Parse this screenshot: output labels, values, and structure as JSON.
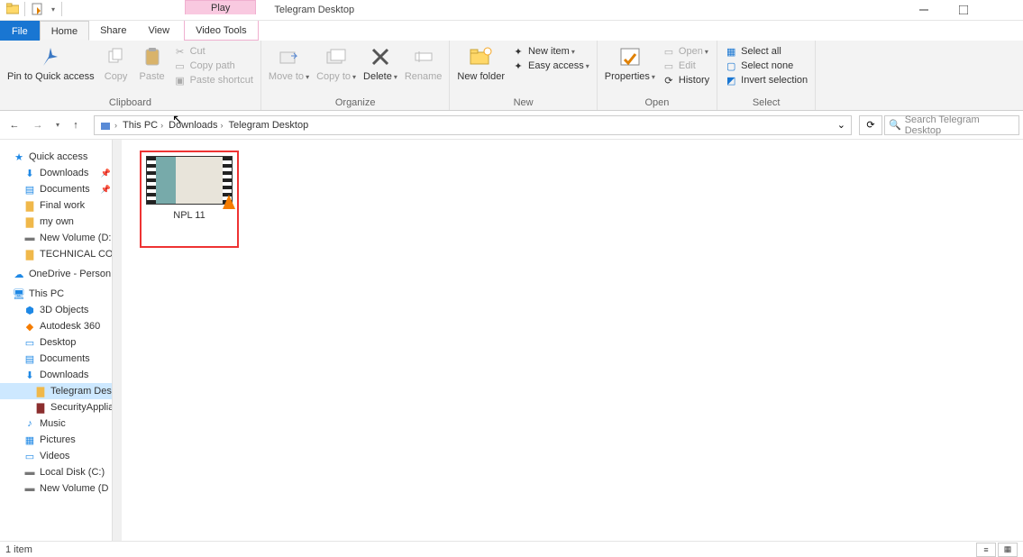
{
  "window": {
    "title": "Telegram Desktop",
    "play_label": "Play"
  },
  "tabs": {
    "file": "File",
    "home": "Home",
    "share": "Share",
    "view": "View",
    "video_tools": "Video Tools"
  },
  "ribbon": {
    "clipboard": {
      "label": "Clipboard",
      "pin": "Pin to Quick access",
      "copy": "Copy",
      "paste": "Paste",
      "cut": "Cut",
      "copy_path": "Copy path",
      "paste_shortcut": "Paste shortcut"
    },
    "organize": {
      "label": "Organize",
      "move_to": "Move to",
      "copy_to": "Copy to",
      "delete": "Delete",
      "rename": "Rename"
    },
    "new": {
      "label": "New",
      "new_folder": "New folder",
      "new_item": "New item",
      "easy_access": "Easy access"
    },
    "open": {
      "label": "Open",
      "properties": "Properties",
      "open": "Open",
      "edit": "Edit",
      "history": "History"
    },
    "select": {
      "label": "Select",
      "select_all": "Select all",
      "select_none": "Select none",
      "invert": "Invert selection"
    }
  },
  "breadcrumb": {
    "items": [
      "This PC",
      "Downloads",
      "Telegram Desktop"
    ]
  },
  "search": {
    "placeholder": "Search Telegram Desktop"
  },
  "sidebar": {
    "quick_access": "Quick access",
    "qa_items": [
      {
        "icon": "download",
        "label": "Downloads",
        "pinned": true
      },
      {
        "icon": "doc",
        "label": "Documents",
        "pinned": true
      },
      {
        "icon": "folder",
        "label": "Final work",
        "pinned": false
      },
      {
        "icon": "folder",
        "label": "my own",
        "pinned": false
      },
      {
        "icon": "drive",
        "label": "New Volume (D:",
        "pinned": false
      },
      {
        "icon": "folder",
        "label": "TECHNICAL COI",
        "pinned": false
      }
    ],
    "onedrive": "OneDrive - Person",
    "this_pc": "This PC",
    "pc_items": [
      {
        "icon": "3d",
        "label": "3D Objects"
      },
      {
        "icon": "autodesk",
        "label": "Autodesk 360"
      },
      {
        "icon": "desktop",
        "label": "Desktop"
      },
      {
        "icon": "doc",
        "label": "Documents"
      },
      {
        "icon": "download",
        "label": "Downloads"
      },
      {
        "icon": "folder",
        "label": "Telegram Deskt",
        "selected": true,
        "lvl": 3
      },
      {
        "icon": "archive",
        "label": "SecurityApplian",
        "lvl": 3
      },
      {
        "icon": "music",
        "label": "Music"
      },
      {
        "icon": "pictures",
        "label": "Pictures"
      },
      {
        "icon": "videos",
        "label": "Videos"
      },
      {
        "icon": "drive",
        "label": "Local Disk (C:)"
      },
      {
        "icon": "drive",
        "label": "New Volume (D"
      }
    ]
  },
  "content": {
    "files": [
      {
        "name": "NPL 11",
        "type": "video"
      }
    ]
  },
  "status": {
    "text": "1 item"
  }
}
